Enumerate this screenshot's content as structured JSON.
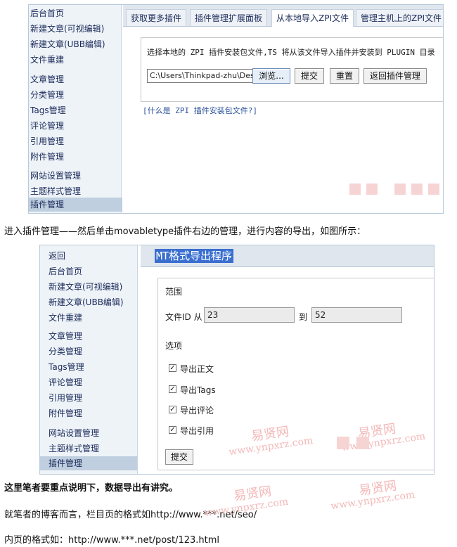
{
  "shot1": {
    "sidebar": [
      "后台首页",
      "新建文章(可视编辑)",
      "新建文章(UBB编辑)",
      "文件重建",
      "文章管理",
      "分类管理",
      "Tags管理",
      "评论管理",
      "引用管理",
      "附件管理",
      "网站设置管理",
      "主题样式管理",
      "插件管理"
    ],
    "tabs": [
      "获取更多插件",
      "插件管理扩展面板",
      "从本地导入ZPI文件",
      "管理主机上的ZPI文件"
    ],
    "instruction": "选择本地的 ZPI 插件安装包文件,TS 将从该文件导入插件并安装到 PLUGIN 目录",
    "file_path": "C:\\Users\\Thinkpad-zhu\\Des",
    "buttons": {
      "browse": "浏览...",
      "submit": "提交",
      "reset": "重置",
      "back": "返回插件管理"
    },
    "help_link": "[什么是 ZPI 插件安装包文件?]"
  },
  "caption1": "进入插件管理——然后单击movabletype插件右边的管理，进行内容的导出，如图所示：",
  "shot2": {
    "sidebar": [
      "返回",
      "后台首页",
      "新建文章(可视编辑)",
      "新建文章(UBB编辑)",
      "文件重建",
      "文章管理",
      "分类管理",
      "Tags管理",
      "评论管理",
      "引用管理",
      "附件管理",
      "网站设置管理",
      "主题样式管理",
      "插件管理"
    ],
    "title": "MT格式导出程序",
    "range_label": "范围",
    "id_label": "文件ID 从",
    "from_value": "23",
    "to_label": "到",
    "to_value": "52",
    "options_label": "选项",
    "options": [
      "导出正文",
      "导出Tags",
      "导出评论",
      "导出引用"
    ],
    "submit": "提交"
  },
  "watermark": {
    "brand": "易贤网",
    "url": "www.ynpxrz.com"
  },
  "text": {
    "bold_line": "这里笔者要重点说明下，数据导出有讲究。",
    "line2": "就笔者的博客而言，栏目页的格式如http://www.***.net/seo/",
    "line3": "内页的格式如：http://www.***.net/post/123.html"
  }
}
